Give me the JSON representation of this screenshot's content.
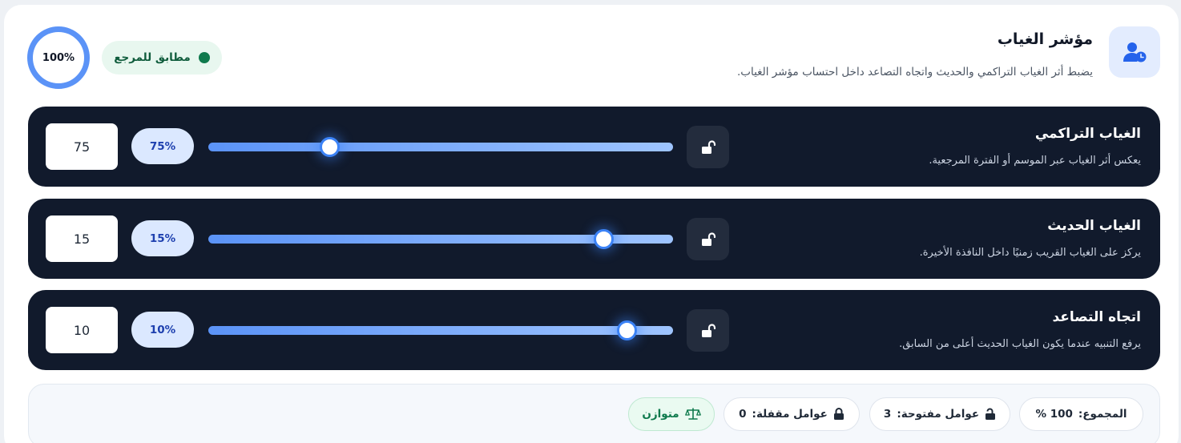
{
  "header": {
    "title": "مؤشر الغياب",
    "subtitle": "يضبط أثر الغياب التراكمي والحديث واتجاه التصاعد داخل احتساب مؤشر الغياب.",
    "icon": "user-clock-icon",
    "total_ring": "100%",
    "status_label": "مطابق للمرجع"
  },
  "factors": [
    {
      "title": "الغياب التراكمي",
      "description": "يعكس أثر الغياب عبر الموسم أو الفترة المرجعية.",
      "percent_label": "75%",
      "value": "75",
      "slider_position": 0.26,
      "locked": false
    },
    {
      "title": "الغياب الحديث",
      "description": "يركز على الغياب القريب زمنيًا داخل النافذة الأخيرة.",
      "percent_label": "15%",
      "value": "15",
      "slider_position": 0.85,
      "locked": false
    },
    {
      "title": "اتجاه التصاعد",
      "description": "يرفع التنبيه عندما يكون الغياب الحديث أعلى من السابق.",
      "percent_label": "10%",
      "value": "10",
      "slider_position": 0.9,
      "locked": false
    }
  ],
  "summary": {
    "total_label": "المجموع:",
    "total_value": "100 %",
    "open_label": "عوامل مفتوحة:",
    "open_value": "3",
    "locked_label": "عوامل مقفلة:",
    "locked_value": "0",
    "balance_label": "متوازن"
  },
  "colors": {
    "accent": "#3b82f6",
    "row_bg": "#111a2c",
    "success": "#0f7a4d"
  }
}
